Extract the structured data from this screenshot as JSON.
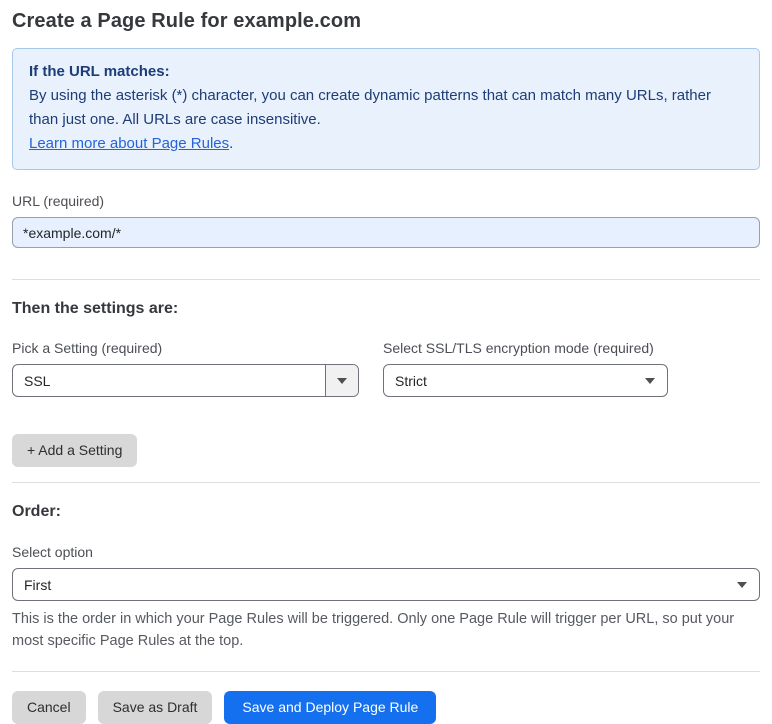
{
  "page": {
    "title": "Create a Page Rule for example.com"
  },
  "info_box": {
    "heading": "If the URL matches:",
    "body": "By using the asterisk (*) character, you can create dynamic patterns that can match many URLs, rather than just one. All URLs are case insensitive.",
    "link_label": "Learn more about Page Rules",
    "link_suffix": "."
  },
  "url_field": {
    "label": "URL (required)",
    "value": "*example.com/*"
  },
  "settings": {
    "heading": "Then the settings are:",
    "setting_picker": {
      "label": "Pick a Setting (required)",
      "selected": "SSL"
    },
    "mode_picker": {
      "label": "Select SSL/TLS encryption mode (required)",
      "selected": "Strict"
    },
    "add_button_label": "+ Add a Setting"
  },
  "order": {
    "heading": "Order:",
    "label": "Select option",
    "selected": "First",
    "help": "This is the order in which your Page Rules will be triggered. Only one Page Rule will trigger per URL, so put your most specific Page Rules at the top."
  },
  "footer": {
    "cancel_label": "Cancel",
    "save_draft_label": "Save as Draft",
    "save_deploy_label": "Save and Deploy Page Rule"
  },
  "colors": {
    "primary_button_blue": "#1570ef",
    "info_box_background": "#e9f2fc",
    "info_box_border": "#a7c8ec",
    "info_box_text": "#1d3c78",
    "link_blue": "#2563d9",
    "url_input_background": "#e7f0fe",
    "gray_button_background": "#d7d7d7",
    "divider_gray": "#dcdddf"
  }
}
